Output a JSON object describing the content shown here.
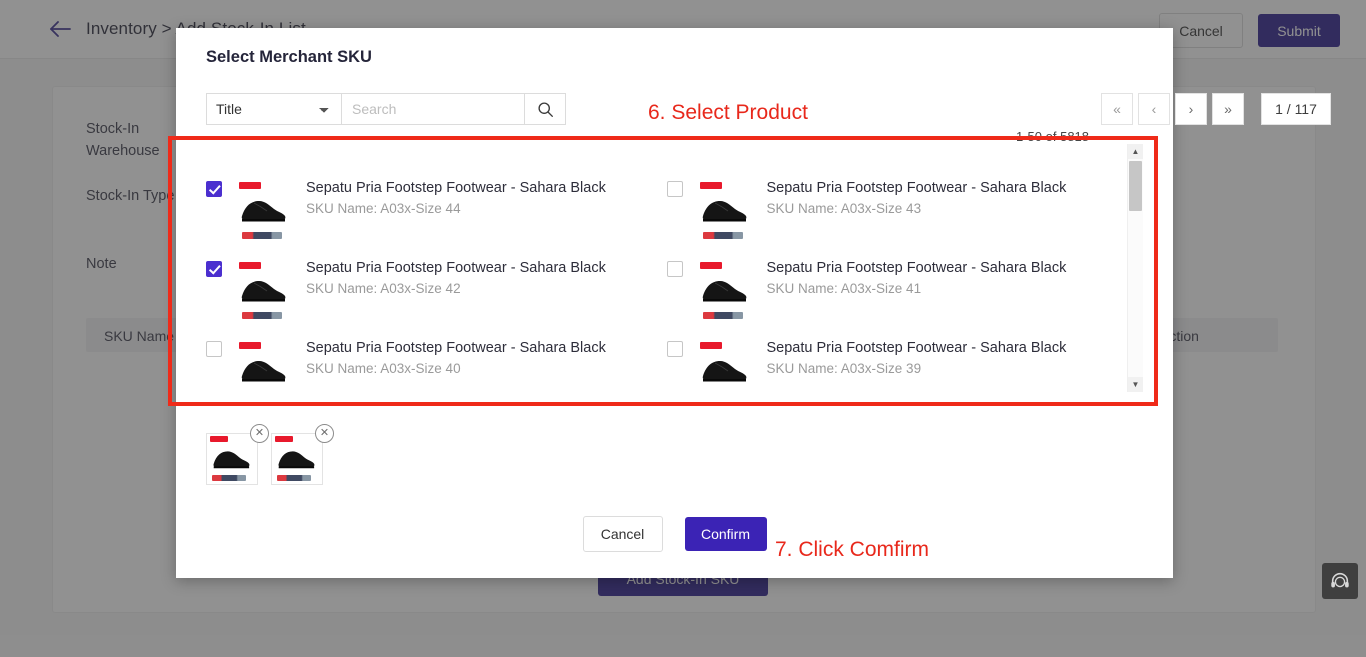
{
  "background": {
    "breadcrumb": "Inventory > Add Stock-In List",
    "back_icon": "arrow-left-icon",
    "cancel_label": "Cancel",
    "submit_label": "Submit",
    "form_labels": {
      "warehouse": "Stock-In Warehouse",
      "type": "Stock-In Type",
      "note": "Note"
    },
    "table_headers": {
      "sku_name": "SKU Name",
      "action": "Action"
    },
    "add_button_label": "Add Stock-In SKU",
    "support_icon": "headset-support-icon"
  },
  "modal": {
    "title": "Select Merchant SKU",
    "search": {
      "field_selected": "Title",
      "field_options": [
        "Title"
      ],
      "placeholder": "Search",
      "value": "",
      "search_icon": "search-icon",
      "dropdown_icon": "chevron-down-icon"
    },
    "pagination": {
      "range_text": "1-50 of 5818",
      "first_icon": "«",
      "prev_icon": "‹",
      "next_icon": "›",
      "last_icon": "»",
      "page_display": "1 / 117"
    },
    "items": [
      {
        "checked": true,
        "title": "Sepatu Pria Footstep Footwear - Sahara Black",
        "sku": "SKU Name: A03x-Size 44"
      },
      {
        "checked": false,
        "title": "Sepatu Pria Footstep Footwear - Sahara Black",
        "sku": "SKU Name: A03x-Size 43"
      },
      {
        "checked": true,
        "title": "Sepatu Pria Footstep Footwear - Sahara Black",
        "sku": "SKU Name: A03x-Size 42"
      },
      {
        "checked": false,
        "title": "Sepatu Pria Footstep Footwear - Sahara Black",
        "sku": "SKU Name: A03x-Size 41"
      },
      {
        "checked": false,
        "title": "Sepatu Pria Footstep Footwear - Sahara Black",
        "sku": "SKU Name: A03x-Size 40"
      },
      {
        "checked": false,
        "title": "Sepatu Pria Footstep Footwear - Sahara Black",
        "sku": "SKU Name: A03x-Size 39"
      }
    ],
    "selected_chips": [
      {
        "remove_icon": "close-circle-icon"
      },
      {
        "remove_icon": "close-circle-icon"
      }
    ],
    "footer": {
      "cancel_label": "Cancel",
      "confirm_label": "Confirm"
    }
  },
  "annotations": {
    "step6": "6. Select Product",
    "step7": "7. Click Comfirm",
    "color": "#e8281b"
  }
}
